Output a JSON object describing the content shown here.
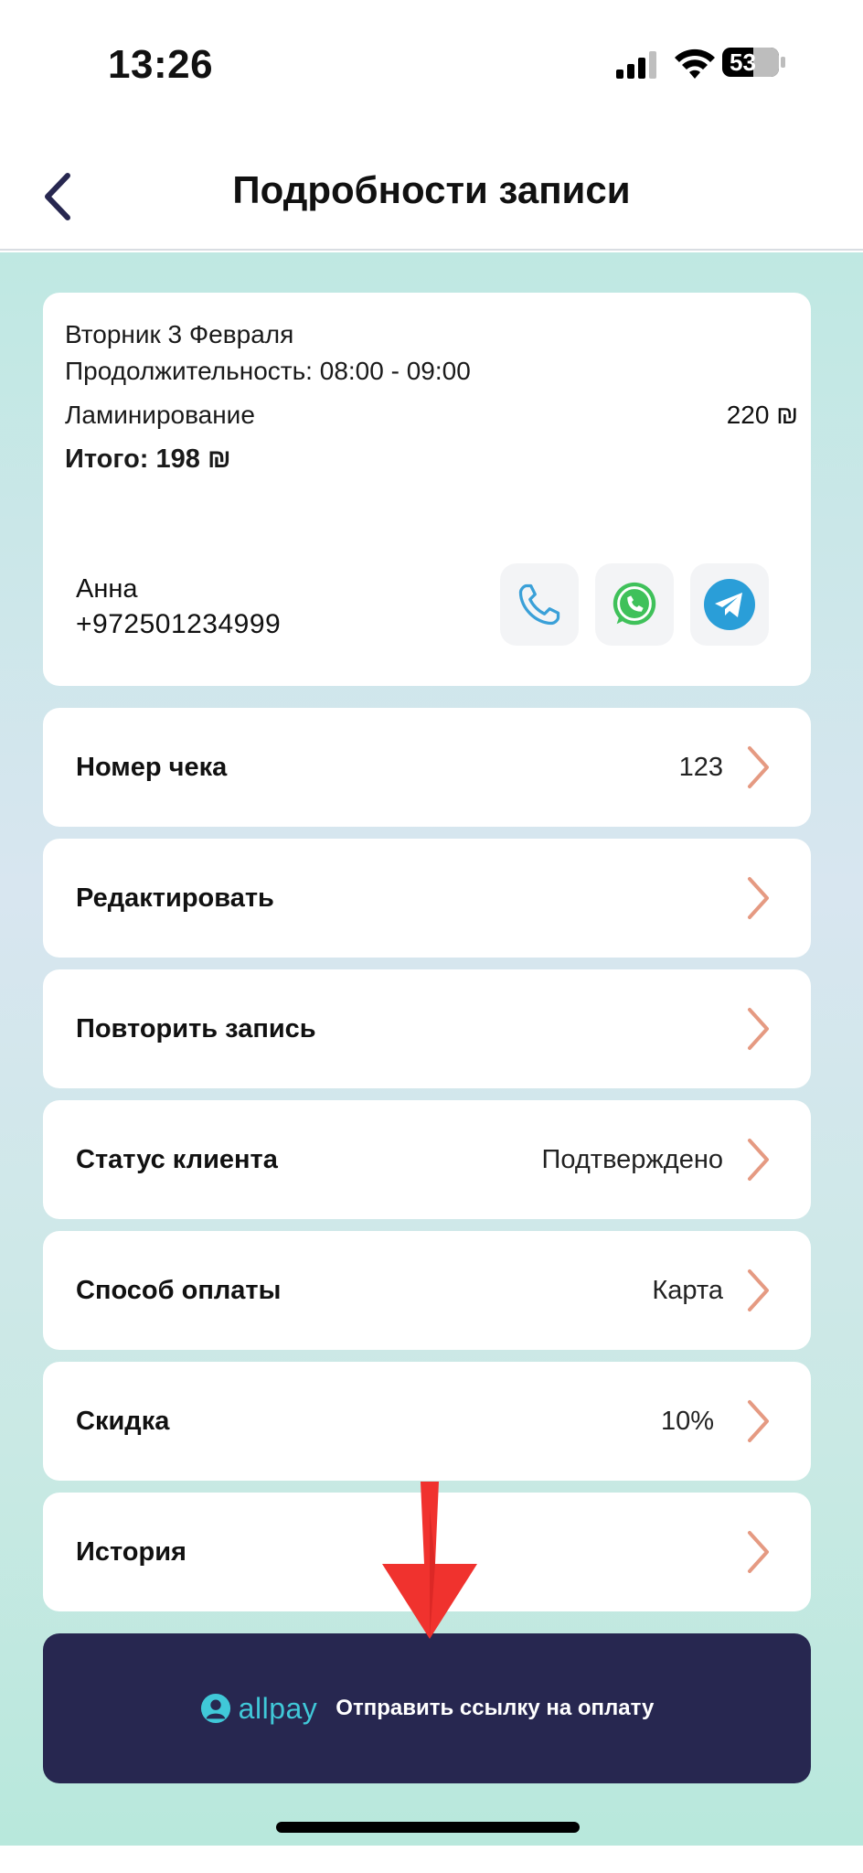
{
  "status_bar": {
    "time": "13:26",
    "battery": "53"
  },
  "nav": {
    "title": "Подробности записи"
  },
  "info": {
    "date": "Вторник 3 Февраля",
    "duration": "Продолжительность: 08:00 - 09:00",
    "service": "Ламинирование",
    "service_price": "220 ₪",
    "total": "Итого: 198 ₪",
    "client_name": "Анна",
    "client_phone": "+972501234999"
  },
  "rows": [
    {
      "label": "Номер чека",
      "value": "123"
    },
    {
      "label": "Редактировать",
      "value": ""
    },
    {
      "label": "Повторить запись",
      "value": ""
    },
    {
      "label": "Статус клиента",
      "value": "Подтверждено"
    },
    {
      "label": "Способ оплаты",
      "value": "Карта"
    },
    {
      "label": "Скидка",
      "value": "10%"
    },
    {
      "label": "История",
      "value": ""
    }
  ],
  "pay_button": {
    "logo": "allpay",
    "label": "Отправить ссылку на оплату"
  },
  "colors": {
    "accent_chevron": "#e59a82",
    "pay_bg": "#272750",
    "allpay_teal": "#40c8d8",
    "telegram": "#2a9ed8",
    "whatsapp": "#3fc15a"
  }
}
